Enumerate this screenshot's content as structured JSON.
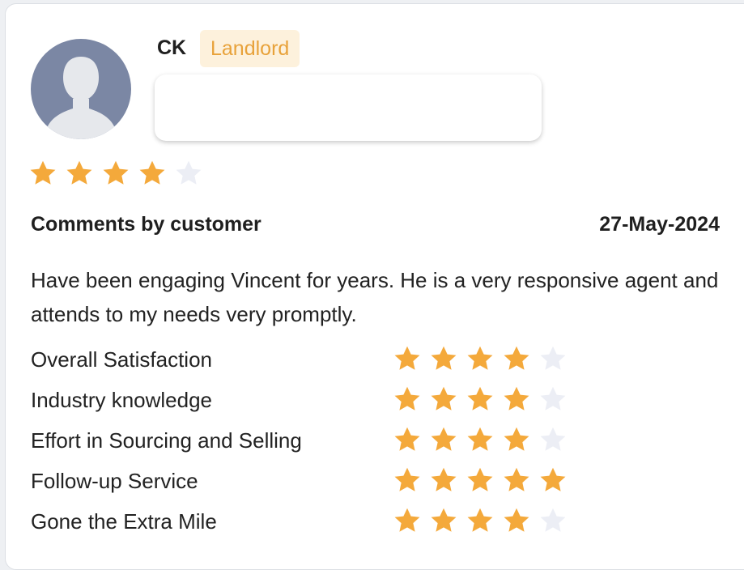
{
  "reviewer": {
    "initials": "CK",
    "role": "Landlord",
    "avatar_icon": "user-silhouette-icon"
  },
  "overall_rating": 4,
  "max_rating": 5,
  "comments": {
    "heading": "Comments by customer",
    "date": "27-May-2024",
    "text": "Have been engaging Vincent for years. He is a very responsive agent and attends to my needs very promptly."
  },
  "ratings": [
    {
      "label": "Overall Satisfaction",
      "value": 4
    },
    {
      "label": "Industry knowledge",
      "value": 4
    },
    {
      "label": "Effort in Sourcing and Selling",
      "value": 4
    },
    {
      "label": "Follow-up Service",
      "value": 5
    },
    {
      "label": "Gone the Extra Mile",
      "value": 4
    }
  ],
  "colors": {
    "star_filled": "#F4A93B",
    "star_empty": "#ECEEF5",
    "badge_bg": "#FDF1DC",
    "badge_text": "#E8A23A",
    "avatar_bg": "#7B87A4"
  }
}
